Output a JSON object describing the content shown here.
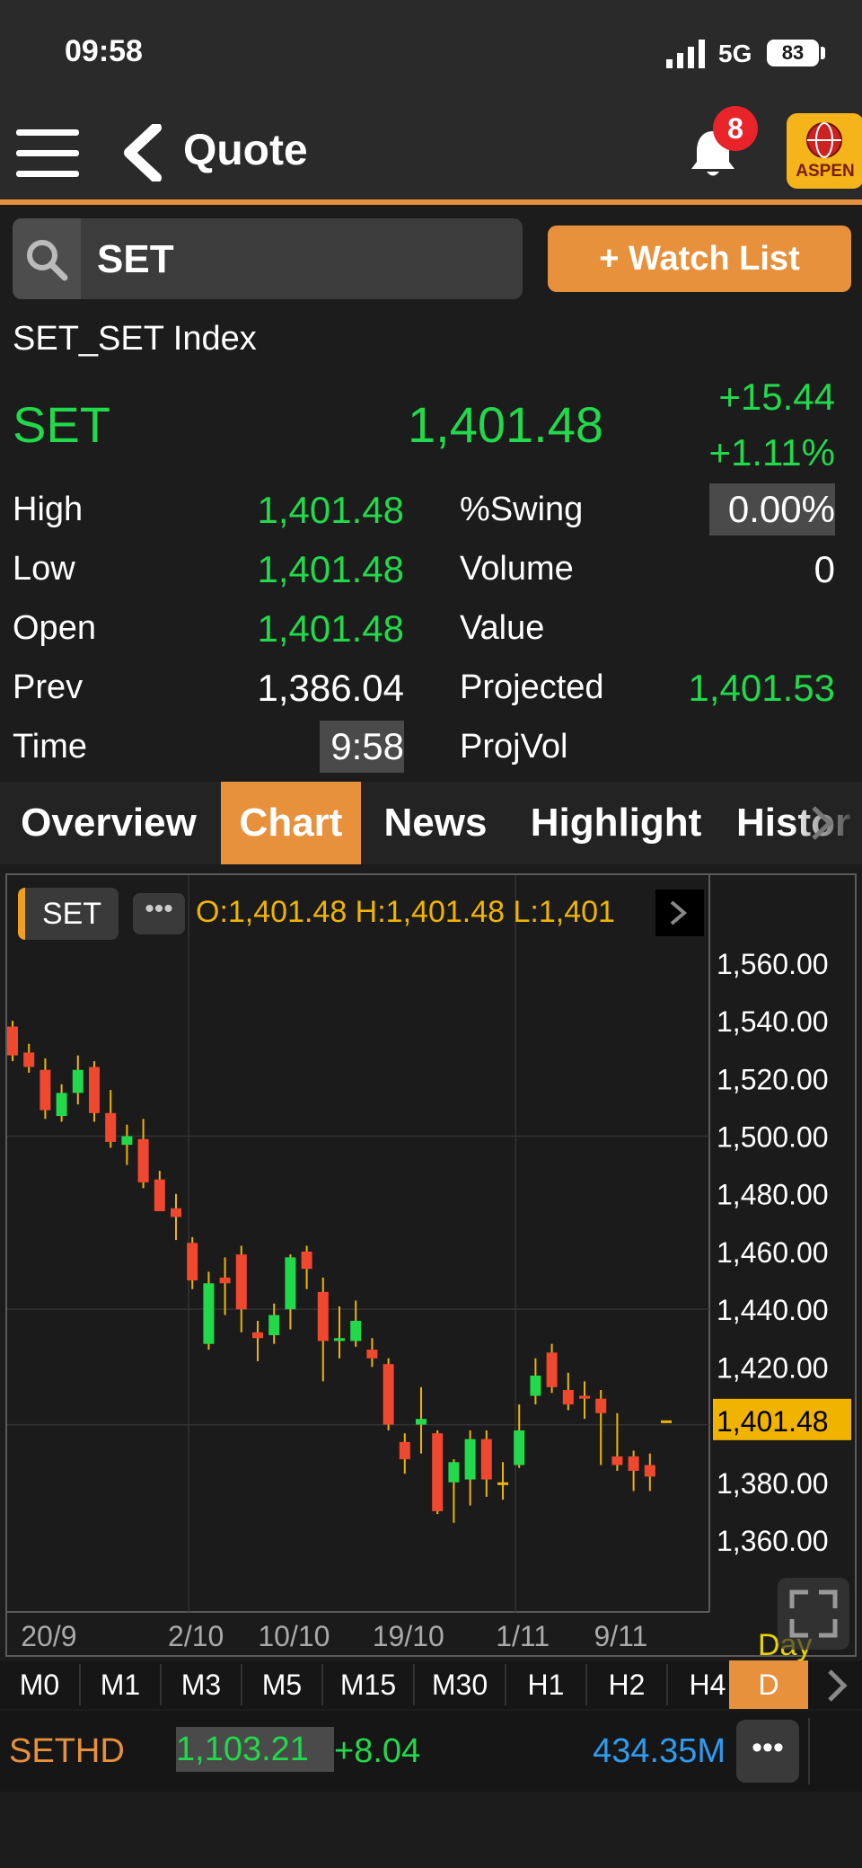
{
  "status_bar": {
    "time": "09:58",
    "network": "5G",
    "battery": "83"
  },
  "header": {
    "title": "Quote",
    "notification_count": "8",
    "logo_text": "ASPEN"
  },
  "search": {
    "value": "SET",
    "watchlist_button": "+ Watch List"
  },
  "symbol": {
    "full_name": "SET_SET Index",
    "code": "SET",
    "last": "1,401.48",
    "change": "+15.44",
    "change_pct": "+1.11%"
  },
  "stats": {
    "high_label": "High",
    "high_value": "1,401.48",
    "low_label": "Low",
    "low_value": "1,401.48",
    "open_label": "Open",
    "open_value": "1,401.48",
    "prev_label": "Prev",
    "prev_value": "1,386.04",
    "time_label": "Time",
    "time_value": "9:58",
    "swing_label": "%Swing",
    "swing_value": "0.00%",
    "volume_label": "Volume",
    "volume_value": "0",
    "value_label": "Value",
    "value_value": "",
    "projected_label": "Projected",
    "projected_value": "1,401.53",
    "projvol_label": "ProjVol",
    "projvol_value": ""
  },
  "tabs": [
    "Overview",
    "Chart",
    "News",
    "Highlight",
    "Histor"
  ],
  "active_tab": "Chart",
  "chart_header": {
    "symbol": "SET",
    "ohlc_text": "O:1,401.48  H:1,401.48  L:1,401"
  },
  "chart_data": {
    "type": "candlestick",
    "ylim": [
      1355,
      1565
    ],
    "y_ticks": [
      "1,560.00",
      "1,540.00",
      "1,520.00",
      "1,500.00",
      "1,480.00",
      "1,460.00",
      "1,440.00",
      "1,420.00",
      "1,380.00",
      "1,360.00"
    ],
    "y_tick_values": [
      1560,
      1540,
      1520,
      1500,
      1480,
      1460,
      1440,
      1420,
      1380,
      1360
    ],
    "last_price_label": "1,401.48",
    "last_price_value": 1401.48,
    "x_tick_labels": [
      "20/9",
      "2/10",
      "10/10",
      "19/10",
      "1/11",
      "9/11"
    ],
    "x_tick_indices": [
      2,
      11,
      17,
      24,
      31,
      37
    ],
    "period_label": "Day",
    "candles": [
      {
        "o": 1538,
        "h": 1540,
        "l": 1526,
        "c": 1528
      },
      {
        "o": 1529,
        "h": 1532,
        "l": 1522,
        "c": 1524
      },
      {
        "o": 1523,
        "h": 1527,
        "l": 1506,
        "c": 1509
      },
      {
        "o": 1507,
        "h": 1518,
        "l": 1505,
        "c": 1515
      },
      {
        "o": 1515,
        "h": 1528,
        "l": 1511,
        "c": 1523
      },
      {
        "o": 1524,
        "h": 1526,
        "l": 1505,
        "c": 1508
      },
      {
        "o": 1508,
        "h": 1516,
        "l": 1496,
        "c": 1498
      },
      {
        "o": 1497,
        "h": 1504,
        "l": 1490,
        "c": 1500
      },
      {
        "o": 1499,
        "h": 1506,
        "l": 1482,
        "c": 1484
      },
      {
        "o": 1485,
        "h": 1488,
        "l": 1474,
        "c": 1474
      },
      {
        "o": 1475,
        "h": 1480,
        "l": 1464,
        "c": 1472
      },
      {
        "o": 1463,
        "h": 1465,
        "l": 1447,
        "c": 1450
      },
      {
        "o": 1428,
        "h": 1453,
        "l": 1426,
        "c": 1449
      },
      {
        "o": 1451,
        "h": 1458,
        "l": 1438,
        "c": 1449
      },
      {
        "o": 1459,
        "h": 1462,
        "l": 1432,
        "c": 1440
      },
      {
        "o": 1432,
        "h": 1436,
        "l": 1422,
        "c": 1430
      },
      {
        "o": 1431,
        "h": 1442,
        "l": 1428,
        "c": 1438
      },
      {
        "o": 1440,
        "h": 1459,
        "l": 1433,
        "c": 1458
      },
      {
        "o": 1460,
        "h": 1462,
        "l": 1447,
        "c": 1454
      },
      {
        "o": 1446,
        "h": 1451,
        "l": 1415,
        "c": 1429
      },
      {
        "o": 1429,
        "h": 1441,
        "l": 1423,
        "c": 1430
      },
      {
        "o": 1429,
        "h": 1443,
        "l": 1427,
        "c": 1436
      },
      {
        "o": 1426,
        "h": 1430,
        "l": 1420,
        "c": 1423
      },
      {
        "o": 1421,
        "h": 1423,
        "l": 1398,
        "c": 1400
      },
      {
        "o": 1394,
        "h": 1397,
        "l": 1383,
        "c": 1388
      },
      {
        "o": 1400,
        "h": 1413,
        "l": 1390,
        "c": 1402
      },
      {
        "o": 1397,
        "h": 1398,
        "l": 1369,
        "c": 1370
      },
      {
        "o": 1380,
        "h": 1388,
        "l": 1366,
        "c": 1387
      },
      {
        "o": 1381,
        "h": 1398,
        "l": 1372,
        "c": 1395
      },
      {
        "o": 1395,
        "h": 1398,
        "l": 1375,
        "c": 1381
      },
      {
        "o": 1380,
        "h": 1387,
        "l": 1374,
        "c": 1380
      },
      {
        "o": 1386,
        "h": 1407,
        "l": 1385,
        "c": 1398
      },
      {
        "o": 1410,
        "h": 1423,
        "l": 1407,
        "c": 1417
      },
      {
        "o": 1425,
        "h": 1428,
        "l": 1411,
        "c": 1413
      },
      {
        "o": 1412,
        "h": 1418,
        "l": 1405,
        "c": 1407
      },
      {
        "o": 1410,
        "h": 1415,
        "l": 1402,
        "c": 1409
      },
      {
        "o": 1409,
        "h": 1412,
        "l": 1386,
        "c": 1404
      },
      {
        "o": 1389,
        "h": 1404,
        "l": 1384,
        "c": 1386
      },
      {
        "o": 1389,
        "h": 1391,
        "l": 1377,
        "c": 1384
      },
      {
        "o": 1386,
        "h": 1390,
        "l": 1377,
        "c": 1382
      },
      {
        "o": 1401.48,
        "h": 1401.48,
        "l": 1401.48,
        "c": 1401.48
      }
    ]
  },
  "timeframes": [
    "M0",
    "M1",
    "M3",
    "M5",
    "M15",
    "M30",
    "H1",
    "H2",
    "H4",
    "D"
  ],
  "active_timeframe": "D",
  "ticker": {
    "symbol": "SETHD",
    "price": "1,103.21",
    "change": "+8.04",
    "value": "434.35M"
  },
  "colors": {
    "accent": "#e8913c",
    "up": "#22d84b",
    "down": "#f0472f",
    "wick": "#f0b400",
    "value_blue": "#2f9cf0"
  }
}
